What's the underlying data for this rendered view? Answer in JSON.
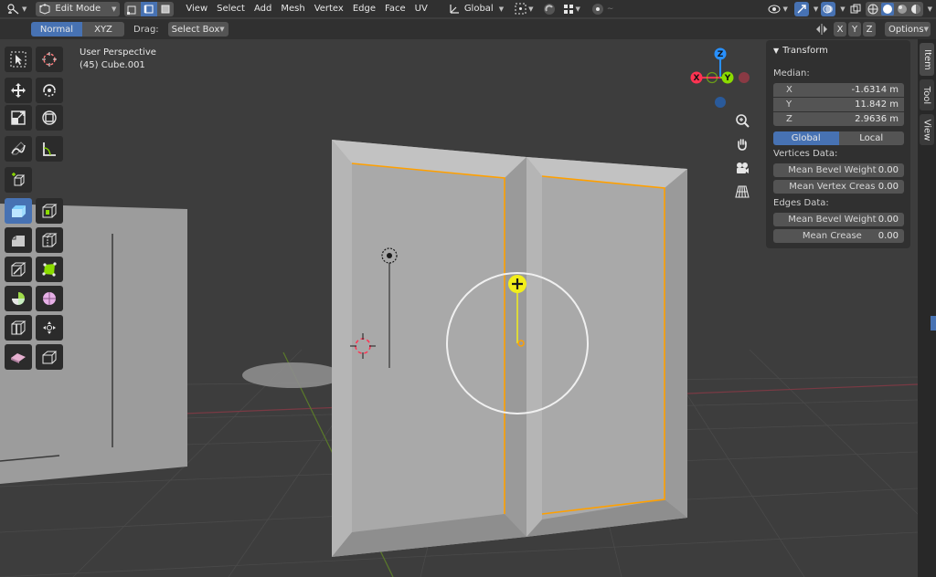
{
  "header": {
    "mode": "Edit Mode",
    "menus": [
      "View",
      "Select",
      "Add",
      "Mesh",
      "Vertex",
      "Edge",
      "Face",
      "UV"
    ],
    "transform_orientation": "Global",
    "options_label": "Options"
  },
  "subheader": {
    "orientation_normal": "Normal",
    "orientation_xyz": "XYZ",
    "drag_label": "Drag:",
    "drag_value": "Select Box",
    "axis_x": "X",
    "axis_y": "Y",
    "axis_z": "Z"
  },
  "viewport": {
    "perspective": "User Perspective",
    "object": "(45) Cube.001"
  },
  "gizmo": {
    "x": "X",
    "y": "Y",
    "z": "Z"
  },
  "npanel": {
    "title": "Transform",
    "median_label": "Median:",
    "median": [
      {
        "axis": "X",
        "value": "-1.6314 m"
      },
      {
        "axis": "Y",
        "value": "11.842 m"
      },
      {
        "axis": "Z",
        "value": "2.9636 m"
      }
    ],
    "space_global": "Global",
    "space_local": "Local",
    "vertices_label": "Vertices Data:",
    "vertices": [
      {
        "label": "Mean Bevel Weight",
        "value": "0.00"
      },
      {
        "label": "Mean Vertex Creas",
        "value": "0.00"
      }
    ],
    "edges_label": "Edges Data:",
    "edges": [
      {
        "label": "Mean Bevel Weight",
        "value": "0.00"
      },
      {
        "label": "Mean Crease",
        "value": "0.00"
      }
    ]
  },
  "tabs": {
    "item": "Item",
    "tool": "Tool",
    "view": "View"
  },
  "colors": {
    "accent": "#4772b3",
    "x_axis": "#ff3352",
    "y_axis": "#8bdc00",
    "z_axis": "#2890ff",
    "selection": "#ffa000",
    "cursor_yellow": "#f2ee1a"
  }
}
